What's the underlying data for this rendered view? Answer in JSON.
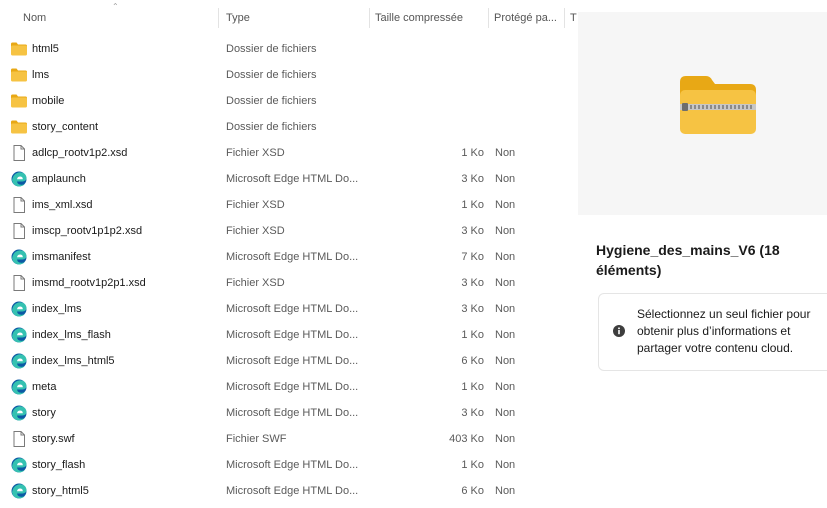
{
  "columns": {
    "name": "Nom",
    "type": "Type",
    "compressed_size": "Taille compressée",
    "protected": "Protégé pa...",
    "truncated": "T"
  },
  "files": [
    {
      "name": "html5",
      "type": "Dossier de fichiers",
      "size": "",
      "protected": "",
      "icon": "folder-icon"
    },
    {
      "name": "lms",
      "type": "Dossier de fichiers",
      "size": "",
      "protected": "",
      "icon": "folder-icon"
    },
    {
      "name": "mobile",
      "type": "Dossier de fichiers",
      "size": "",
      "protected": "",
      "icon": "folder-icon"
    },
    {
      "name": "story_content",
      "type": "Dossier de fichiers",
      "size": "",
      "protected": "",
      "icon": "folder-icon"
    },
    {
      "name": "adlcp_rootv1p2.xsd",
      "type": "Fichier XSD",
      "size": "1 Ko",
      "protected": "Non",
      "icon": "file-icon"
    },
    {
      "name": "amplaunch",
      "type": "Microsoft Edge HTML Do...",
      "size": "3 Ko",
      "protected": "Non",
      "icon": "edge-icon"
    },
    {
      "name": "ims_xml.xsd",
      "type": "Fichier XSD",
      "size": "1 Ko",
      "protected": "Non",
      "icon": "file-icon"
    },
    {
      "name": "imscp_rootv1p1p2.xsd",
      "type": "Fichier XSD",
      "size": "3 Ko",
      "protected": "Non",
      "icon": "file-icon"
    },
    {
      "name": "imsmanifest",
      "type": "Microsoft Edge HTML Do...",
      "size": "7 Ko",
      "protected": "Non",
      "icon": "edge-icon"
    },
    {
      "name": "imsmd_rootv1p2p1.xsd",
      "type": "Fichier XSD",
      "size": "3 Ko",
      "protected": "Non",
      "icon": "file-icon"
    },
    {
      "name": "index_lms",
      "type": "Microsoft Edge HTML Do...",
      "size": "3 Ko",
      "protected": "Non",
      "icon": "edge-icon"
    },
    {
      "name": "index_lms_flash",
      "type": "Microsoft Edge HTML Do...",
      "size": "1 Ko",
      "protected": "Non",
      "icon": "edge-icon"
    },
    {
      "name": "index_lms_html5",
      "type": "Microsoft Edge HTML Do...",
      "size": "6 Ko",
      "protected": "Non",
      "icon": "edge-icon"
    },
    {
      "name": "meta",
      "type": "Microsoft Edge HTML Do...",
      "size": "1 Ko",
      "protected": "Non",
      "icon": "edge-icon"
    },
    {
      "name": "story",
      "type": "Microsoft Edge HTML Do...",
      "size": "3 Ko",
      "protected": "Non",
      "icon": "edge-icon"
    },
    {
      "name": "story.swf",
      "type": "Fichier SWF",
      "size": "403 Ko",
      "protected": "Non",
      "icon": "file-icon"
    },
    {
      "name": "story_flash",
      "type": "Microsoft Edge HTML Do...",
      "size": "1 Ko",
      "protected": "Non",
      "icon": "edge-icon"
    },
    {
      "name": "story_html5",
      "type": "Microsoft Edge HTML Do...",
      "size": "6 Ko",
      "protected": "Non",
      "icon": "edge-icon"
    }
  ],
  "details": {
    "title": "Hygiene_des_mains_V6 (18 éléments)",
    "info_message": "Sélectionnez un seul fichier pour obtenir plus d’informations et partager votre contenu cloud.",
    "preview_icon": "zip-folder-icon"
  },
  "colors": {
    "folder": "#f6c343",
    "folder_dark": "#e8a815",
    "edge_blue": "#0c59a4",
    "edge_green": "#35c1b1",
    "preview_bg": "#f6f6f6"
  }
}
